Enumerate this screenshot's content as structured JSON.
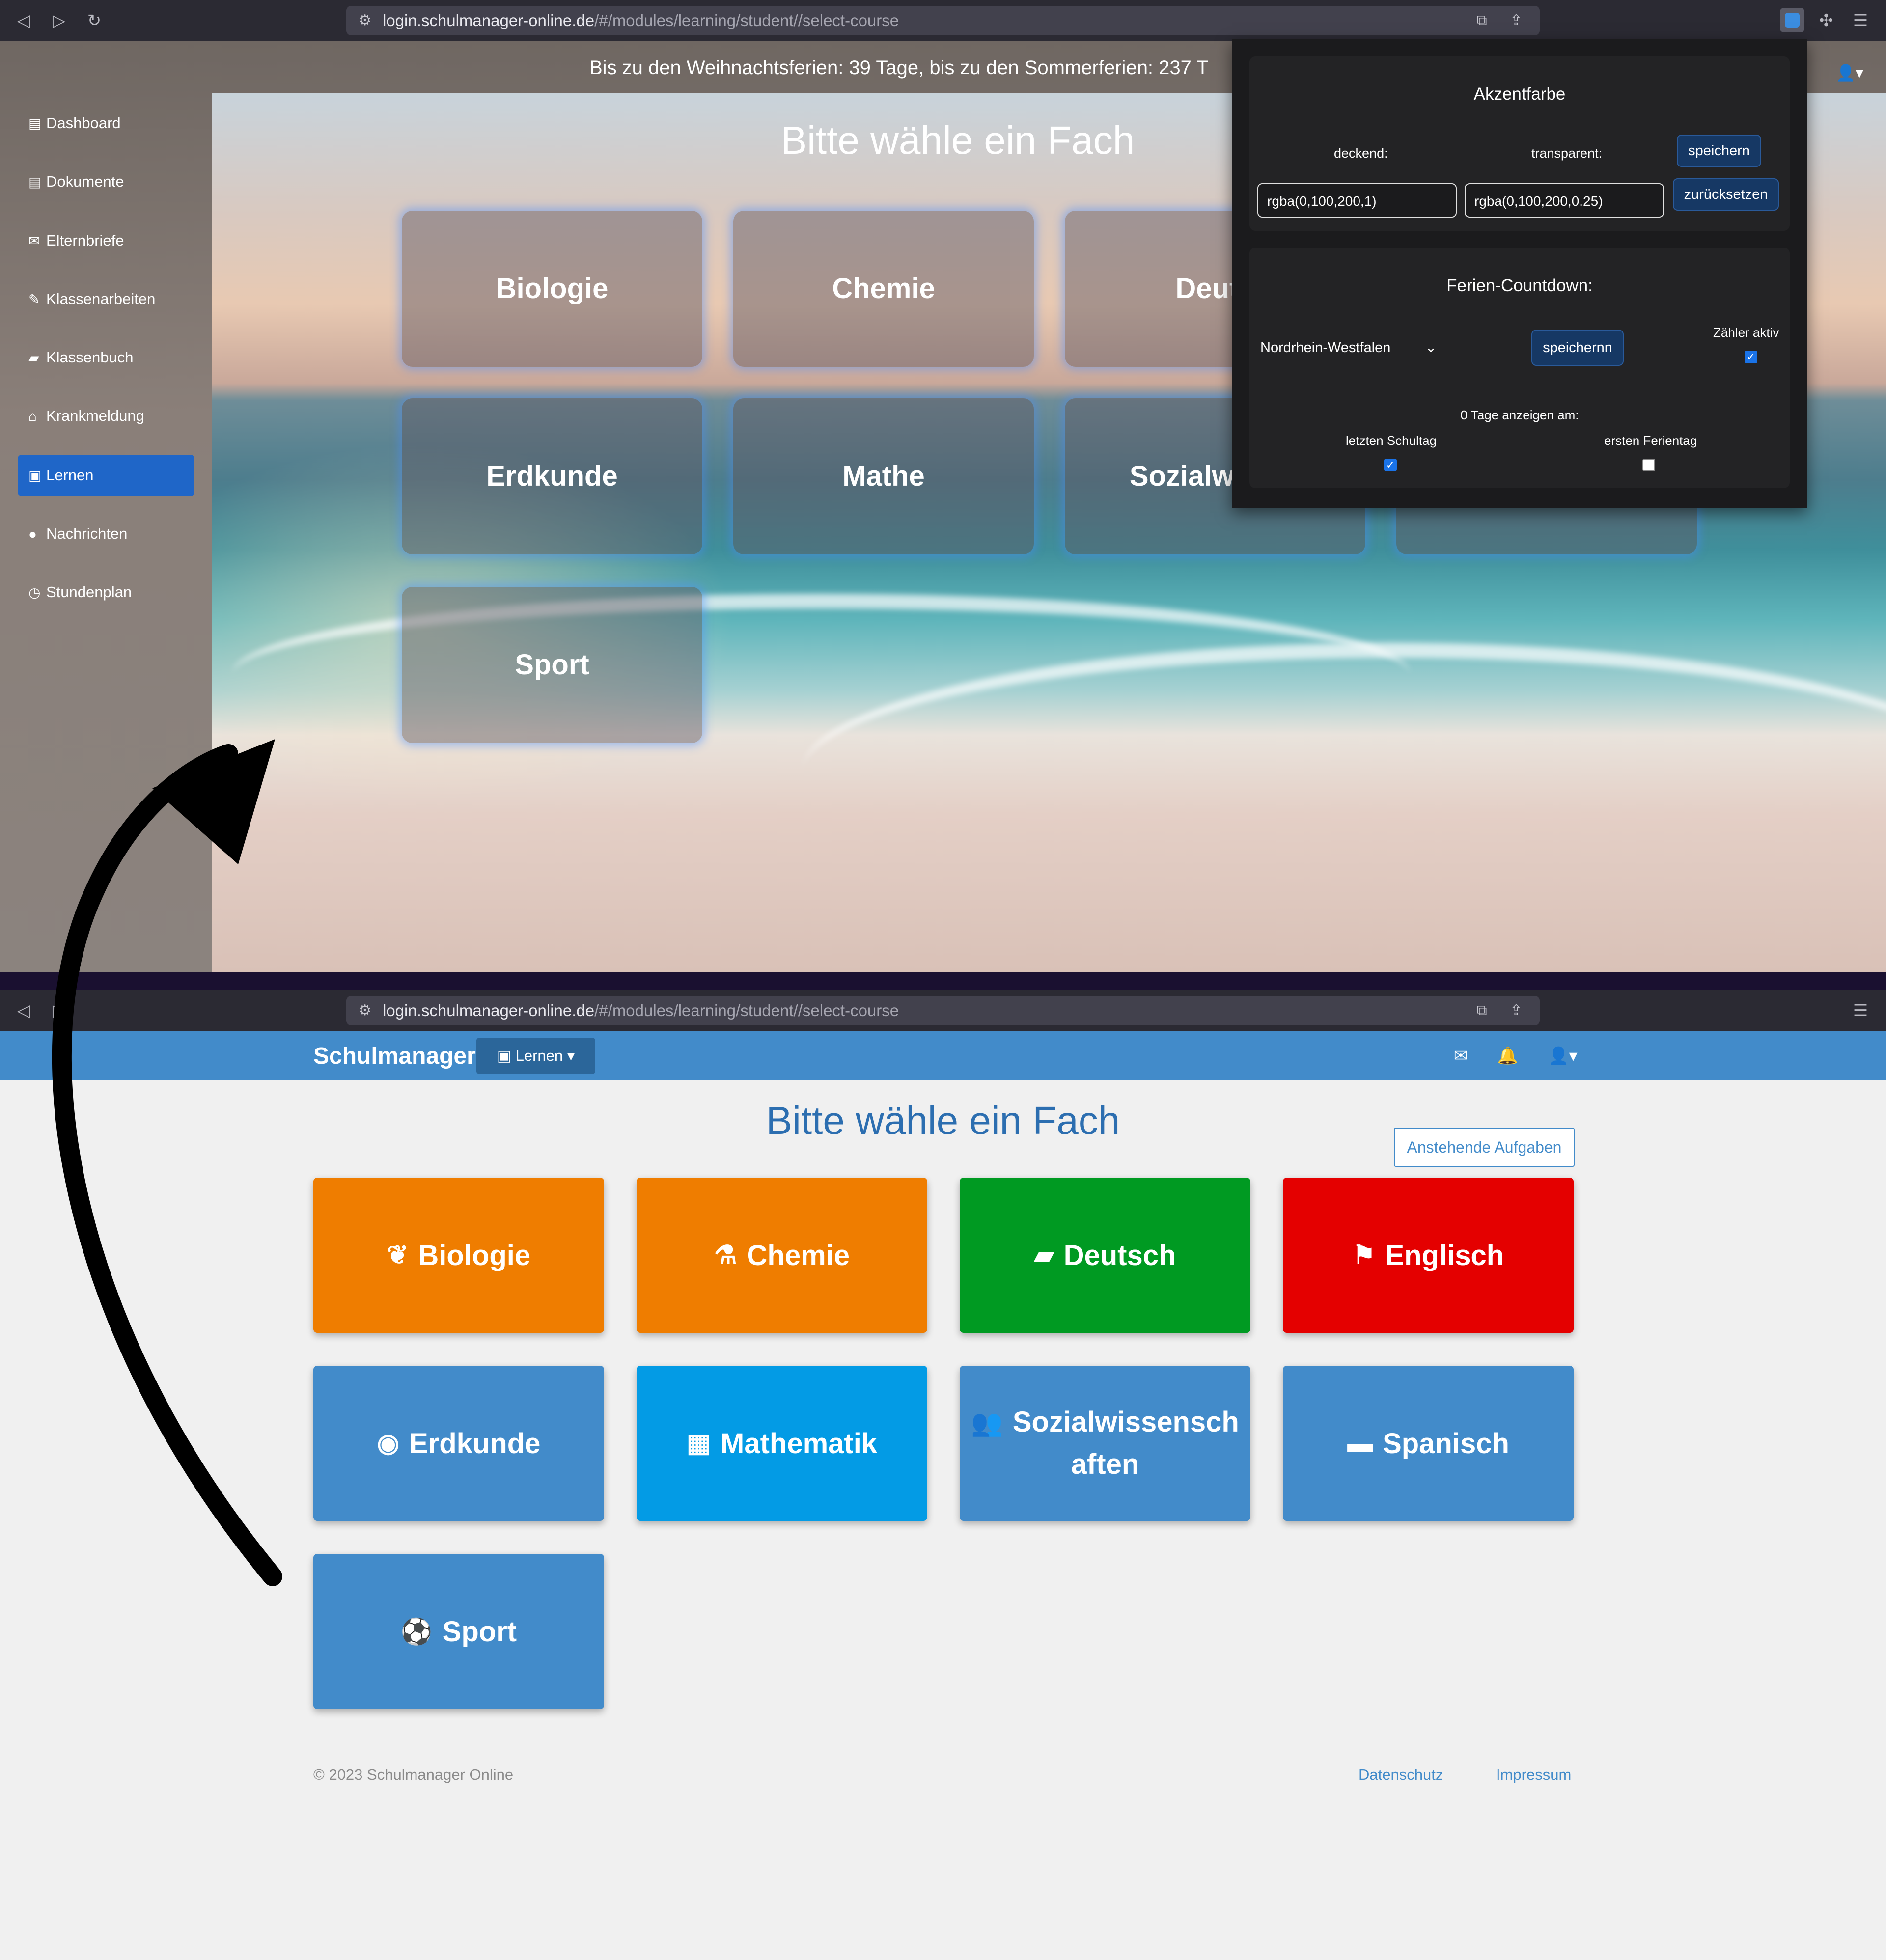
{
  "colors": {
    "accent_blue": "#428bca",
    "active_sidebar": "#1f66c8",
    "orange": "#ef7d00",
    "green": "#009a22",
    "red": "#e40000",
    "blue_tile": "#428bca",
    "cyan_tile": "#039be5",
    "title_blue": "#2c6eb0",
    "popup_bg": "#1b1b1d"
  },
  "top_browser": {
    "url_host": "login.schulmanager-online.de",
    "url_path": "/#/modules/learning/student//select-course"
  },
  "top_app": {
    "countdown": "Bis zu den Weihnachtsferien: 39 Tage, bis zu den Sommerferien: 237 T",
    "title": "Bitte wähle ein Fach",
    "sidebar": [
      {
        "label": "Dashboard",
        "icon": "file-icon"
      },
      {
        "label": "Dokumente",
        "icon": "file-icon"
      },
      {
        "label": "Elternbriefe",
        "icon": "envelope-icon"
      },
      {
        "label": "Klassenarbeiten",
        "icon": "edit-icon"
      },
      {
        "label": "Klassenbuch",
        "icon": "book-icon"
      },
      {
        "label": "Krankmeldung",
        "icon": "home-icon"
      },
      {
        "label": "Lernen",
        "icon": "id-card-icon"
      },
      {
        "label": "Nachrichten",
        "icon": "comment-icon"
      },
      {
        "label": "Stundenplan",
        "icon": "clock-icon"
      }
    ],
    "cards": [
      "Biologie",
      "Chemie",
      "Deuts",
      "Erdkunde",
      "Mathe",
      "Sozialwisser",
      "Sport"
    ]
  },
  "popup": {
    "accent_title": "Akzentfarbe",
    "opaque_label": "deckend:",
    "transparent_label": "transparent:",
    "save_label": "speichern",
    "reset_label": "zurücksetzen",
    "opaque_value": "rgba(0,100,200,1)",
    "transparent_value": "rgba(0,100,200,0.25)",
    "countdown_title": "Ferien-Countdown:",
    "state_value": "Nordrhein-Westfalen",
    "save2_label": "speichernn",
    "counter_active_label": "Zähler aktiv",
    "counter_active": true,
    "zero_days_label": "0 Tage anzeigen am:",
    "last_school_day_label": "letzten Schultag",
    "last_school_day": true,
    "first_holiday_label": "ersten Ferientag",
    "first_holiday": false
  },
  "bottom_browser": {
    "url_host": "login.schulmanager-online.de",
    "url_path": "/#/modules/learning/student//select-course"
  },
  "bottom_app": {
    "brand": "Schulmanager",
    "nav_lernen": "Lernen",
    "title": "Bitte wähle ein Fach",
    "pending_button": "Anstehende Aufgaben",
    "tiles": [
      {
        "label": "Biologie",
        "icon": "leaf-icon",
        "color": "#ef7d00"
      },
      {
        "label": "Chemie",
        "icon": "flask-icon",
        "color": "#ef7d00"
      },
      {
        "label": "Deutsch",
        "icon": "book-icon",
        "color": "#009a22"
      },
      {
        "label": "Englisch",
        "icon": "flag-icon",
        "color": "#e40000"
      },
      {
        "label": "Erdkunde",
        "icon": "globe-icon",
        "color": "#428bca"
      },
      {
        "label": "Mathematik",
        "icon": "calculator-icon",
        "color": "#039be5"
      },
      {
        "label": "Sozialwissenschaften",
        "icon": "users-icon",
        "color": "#428bca"
      },
      {
        "label": "Spanisch",
        "icon": "folder-icon",
        "color": "#428bca"
      },
      {
        "label": "Sport",
        "icon": "soccer-ball-icon",
        "color": "#428bca"
      }
    ],
    "footer_copyright": "© 2023 Schulmanager Online",
    "footer_privacy": "Datenschutz",
    "footer_imprint": "Impressum"
  }
}
